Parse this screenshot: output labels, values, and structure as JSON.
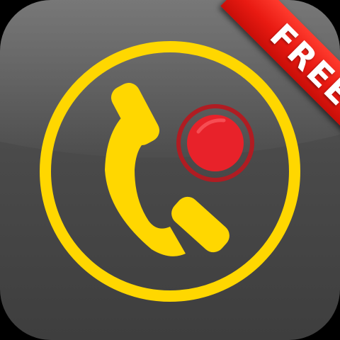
{
  "badge": {
    "label": "FREE"
  },
  "icons": {
    "ring": "yellow-ring",
    "handset": "phone-handset-icon",
    "record": "record-dot-icon"
  },
  "colors": {
    "background": "#4a4a4a",
    "ring": "#ffd700",
    "handset": "#ffd700",
    "record_dot": "#e8222a",
    "record_ring": "#b01c22",
    "banner": "#e81a12",
    "banner_text": "#ffffff"
  }
}
